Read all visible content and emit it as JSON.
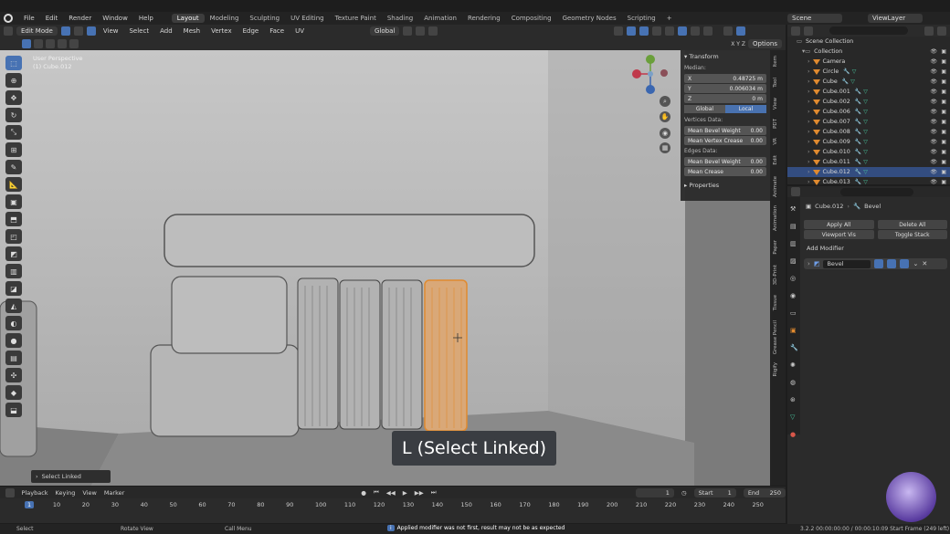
{
  "topbar": {
    "menus": [
      "File",
      "Edit",
      "Render",
      "Window",
      "Help"
    ],
    "workspaces": [
      "Layout",
      "Modeling",
      "Sculpting",
      "UV Editing",
      "Texture Paint",
      "Shading",
      "Animation",
      "Rendering",
      "Compositing",
      "Geometry Nodes",
      "Scripting"
    ],
    "active_workspace": "Layout",
    "scene": "Scene",
    "view_layer": "ViewLayer"
  },
  "viewport_header": {
    "mode": "Edit Mode",
    "menus": [
      "View",
      "Select",
      "Add",
      "Mesh",
      "Vertex",
      "Edge",
      "Face",
      "UV"
    ],
    "orientation": "Global",
    "options_label": "Options"
  },
  "viewport": {
    "perspective": "User Perspective",
    "object_label": "(1) Cube.012",
    "overlay_text": "L (Select Linked)",
    "last_operator": "Select Linked"
  },
  "npanel": {
    "section": "Transform",
    "median_label": "Median:",
    "x_label": "X",
    "x_value": "0.48725 m",
    "y_label": "Y",
    "y_value": "0.006034 m",
    "z_label": "Z",
    "z_value": "0 m",
    "global_label": "Global",
    "local_label": "Local",
    "vertices_data": "Vertices Data:",
    "mean_bevel_weight": "Mean Bevel Weight",
    "mean_bevel_weight_val": "0.00",
    "mean_vertex_crease": "Mean Vertex Crease",
    "mean_vertex_crease_val": "0.00",
    "edges_data": "Edges Data:",
    "edge_bevel_weight": "Mean Bevel Weight",
    "edge_bevel_weight_val": "0.00",
    "mean_crease": "Mean Crease",
    "mean_crease_val": "0.00",
    "properties": "Properties",
    "tabs": [
      "Item",
      "Tool",
      "View",
      "PDT",
      "VR",
      "Edit",
      "Animate",
      "Animation",
      "Paper",
      "3D-Print",
      "Tissue",
      "Grease Pencil",
      "Rigify"
    ]
  },
  "outliner": {
    "root": "Scene Collection",
    "collection": "Collection",
    "items": [
      {
        "name": "Camera",
        "selected": false
      },
      {
        "name": "Circle",
        "selected": false
      },
      {
        "name": "Cube",
        "selected": false
      },
      {
        "name": "Cube.001",
        "selected": false
      },
      {
        "name": "Cube.002",
        "selected": false
      },
      {
        "name": "Cube.006",
        "selected": false
      },
      {
        "name": "Cube.007",
        "selected": false
      },
      {
        "name": "Cube.008",
        "selected": false
      },
      {
        "name": "Cube.009",
        "selected": false
      },
      {
        "name": "Cube.010",
        "selected": false
      },
      {
        "name": "Cube.011",
        "selected": false
      },
      {
        "name": "Cube.012",
        "selected": true
      },
      {
        "name": "Cube.013",
        "selected": false
      }
    ]
  },
  "properties": {
    "object": "Cube.012",
    "modifier_crumb": "Bevel",
    "apply_all": "Apply All",
    "delete_all": "Delete All",
    "viewport_vis": "Viewport Vis",
    "toggle_stack": "Toggle Stack",
    "add_modifier": "Add Modifier",
    "modifier_name": "Bevel"
  },
  "timeline": {
    "menus": [
      "Playback",
      "Keying",
      "View",
      "Marker"
    ],
    "current_frame": "1",
    "start_label": "Start",
    "start_value": "1",
    "end_label": "End",
    "end_value": "250",
    "ticks": [
      "1",
      "10",
      "20",
      "30",
      "40",
      "50",
      "60",
      "70",
      "80",
      "90",
      "100",
      "110",
      "120",
      "130",
      "140",
      "150",
      "160",
      "170",
      "180",
      "190",
      "200",
      "210",
      "220",
      "230",
      "240",
      "250"
    ]
  },
  "status": {
    "select": "Select",
    "rotate": "Rotate View",
    "call_menu": "Call Menu",
    "warning": "Applied modifier was not first, result may not be as expected",
    "info": "3.2.2  00:00:00:00 / 00:00:10:09  Start Frame (249 left)"
  },
  "colors": {
    "accent": "#4772b3",
    "selection_orange": "#e08a2f",
    "viewport_bg": "#b9b9b9"
  }
}
